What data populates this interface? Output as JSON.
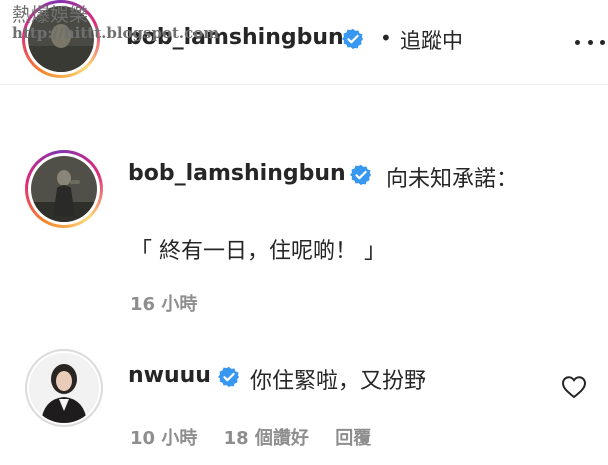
{
  "watermark": {
    "title": "熱爆娛樂",
    "url": "http://hittt.blogspot.com"
  },
  "header": {
    "username": "bob_lamshingbun",
    "separator": "•",
    "follow_status": "追蹤中"
  },
  "caption": {
    "username": "bob_lamshingbun",
    "text_line1": "向未知承諾：",
    "text_line2": "「 終有一日，住呢啲！ 」",
    "time": "16 小時"
  },
  "comment": {
    "username": "nwuuu",
    "text": "你住緊啦，又扮野",
    "time": "10 小時",
    "likes": "18 個讚好",
    "reply": "回覆"
  },
  "colors": {
    "verified": "#3897f0",
    "meta": "#8e8e8e",
    "text": "#262626"
  },
  "icons": [
    "verified-badge-icon",
    "more-options-icon",
    "heart-icon"
  ]
}
